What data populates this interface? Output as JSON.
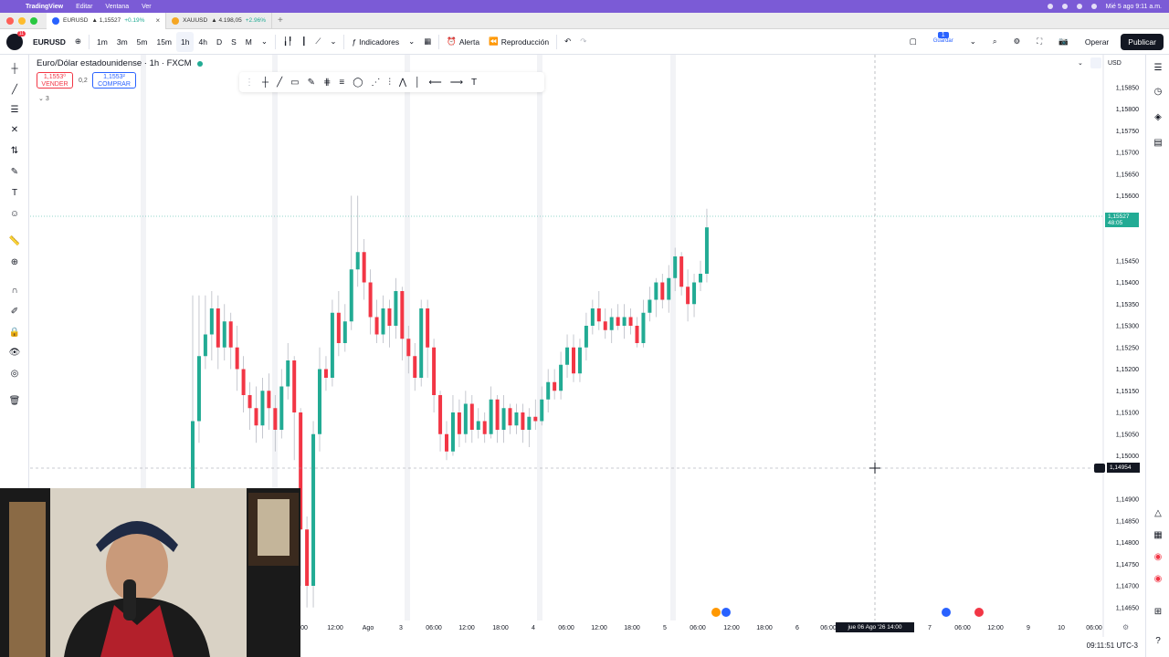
{
  "menubar": {
    "app_name": "TradingView",
    "items": [
      "Editar",
      "Ventana",
      "Ver"
    ],
    "clock": "Mié 5 ago  9:11 a.m."
  },
  "tabs": [
    {
      "symbol": "EURUSD",
      "price": "▲ 1,15527",
      "change": "+0.19%",
      "icon_color": "#2962ff",
      "active": true
    },
    {
      "symbol": "XAUUSD",
      "price": "▲ 4.198,05",
      "change": "+2.96%",
      "icon_color": "#f5a623",
      "active": false
    }
  ],
  "toolbar": {
    "symbol": "EURUSD",
    "intervals": [
      "1m",
      "3m",
      "5m",
      "15m",
      "1h",
      "4h",
      "D",
      "S",
      "M"
    ],
    "selected_interval": "1h",
    "indicators_label": "Indicadores",
    "alert_label": "Alerta",
    "replay_label": "Reproducción",
    "save_badge": "1",
    "save_label": "Guardar",
    "trade_label": "Operar",
    "publish_label": "Publicar"
  },
  "legend": {
    "title": "Euro/Dólar estadounidense · 1h · FXCM",
    "sell_price": "1,1553⁰",
    "sell_label": "VENDER",
    "spread": "0,2",
    "buy_price": "1,1553²",
    "buy_label": "COMPRAR",
    "collapse_count": "3"
  },
  "price_axis": {
    "currency": "USD",
    "current_price": "1,15527",
    "countdown": "48:05",
    "crosshair_price": "1,14954"
  },
  "time_axis": {
    "crosshair_time": "jue 06 Ago '26   14:00",
    "labels": [
      {
        "text": ":00",
        "x": 332
      },
      {
        "text": "12:00",
        "x": 367
      },
      {
        "text": "Ago",
        "x": 403
      },
      {
        "text": "3",
        "x": 439
      },
      {
        "text": "06:00",
        "x": 475
      },
      {
        "text": "12:00",
        "x": 511
      },
      {
        "text": "18:00",
        "x": 548
      },
      {
        "text": "4",
        "x": 584
      },
      {
        "text": "06:00",
        "x": 620
      },
      {
        "text": "12:00",
        "x": 656
      },
      {
        "text": "18:00",
        "x": 692
      },
      {
        "text": "5",
        "x": 728
      },
      {
        "text": "06:00",
        "x": 764
      },
      {
        "text": "12:00",
        "x": 801
      },
      {
        "text": "18:00",
        "x": 837
      },
      {
        "text": "6",
        "x": 873
      },
      {
        "text": "06:00",
        "x": 907
      },
      {
        "text": "7",
        "x": 1018
      },
      {
        "text": "06:00",
        "x": 1054
      },
      {
        "text": "12:00",
        "x": 1090
      },
      {
        "text": "9",
        "x": 1126
      },
      {
        "text": "10",
        "x": 1162
      },
      {
        "text": "06:00",
        "x": 1198
      }
    ],
    "bottom_clock": "09:11:51 UTC-3"
  },
  "chart_data": {
    "type": "candlestick",
    "title": "Euro/Dólar estadounidense · 1h · FXCM",
    "y_ticks": [
      "1,15800",
      "1,15750",
      "1,15700",
      "1,15650",
      "1,15600",
      "1,15550",
      "1,15450",
      "1,15400",
      "1,15350",
      "1,15300",
      "1,15250",
      "1,15200",
      "1,15150",
      "1,15100",
      "1,15050",
      "1,15000",
      "1,14900",
      "1,14850",
      "1,14800",
      "1,14750",
      "1,14700",
      "1,14650"
    ],
    "y_top_label": "1,15850",
    "ylim": [
      1.1462,
      1.159
    ],
    "x_start_index": 0,
    "up_color": "#22ab94",
    "down_color": "#f23645",
    "candles": [
      [
        1.149,
        1.1508,
        1.1537,
        1.1488
      ],
      [
        1.1508,
        1.1523,
        1.1537,
        1.1503
      ],
      [
        1.1523,
        1.1528,
        1.1537,
        1.152
      ],
      [
        1.1528,
        1.1534,
        1.1538,
        1.1522
      ],
      [
        1.1534,
        1.1525,
        1.1537,
        1.152
      ],
      [
        1.1525,
        1.1531,
        1.1535,
        1.1522
      ],
      [
        1.1531,
        1.1525,
        1.1533,
        1.152
      ],
      [
        1.1525,
        1.152,
        1.153,
        1.1515
      ],
      [
        1.152,
        1.1514,
        1.1523,
        1.151
      ],
      [
        1.1514,
        1.1511,
        1.1517,
        1.1506
      ],
      [
        1.1511,
        1.1507,
        1.1516,
        1.1503
      ],
      [
        1.1507,
        1.1515,
        1.1518,
        1.1504
      ],
      [
        1.1515,
        1.1511,
        1.1519,
        1.1506
      ],
      [
        1.1511,
        1.1506,
        1.1514,
        1.1501
      ],
      [
        1.1506,
        1.1516,
        1.152,
        1.1504
      ],
      [
        1.1516,
        1.1522,
        1.1526,
        1.1513
      ],
      [
        1.1522,
        1.151,
        1.1523,
        1.1499
      ],
      [
        1.151,
        1.1483,
        1.1511,
        1.147
      ],
      [
        1.1483,
        1.147,
        1.1486,
        1.1465
      ],
      [
        1.147,
        1.1505,
        1.1508,
        1.1465
      ],
      [
        1.1505,
        1.152,
        1.1525,
        1.1501
      ],
      [
        1.152,
        1.1518,
        1.1523,
        1.1515
      ],
      [
        1.1518,
        1.1533,
        1.1536,
        1.1516
      ],
      [
        1.1533,
        1.1526,
        1.1538,
        1.1523
      ],
      [
        1.1526,
        1.1531,
        1.1535,
        1.1524
      ],
      [
        1.1531,
        1.1543,
        1.156,
        1.1529
      ],
      [
        1.1543,
        1.1547,
        1.156,
        1.1539
      ],
      [
        1.1547,
        1.154,
        1.155,
        1.1536
      ],
      [
        1.154,
        1.1532,
        1.1543,
        1.1528
      ],
      [
        1.1532,
        1.1528,
        1.1536,
        1.1526
      ],
      [
        1.1528,
        1.1534,
        1.1537,
        1.1526
      ],
      [
        1.1534,
        1.153,
        1.1536,
        1.1525
      ],
      [
        1.153,
        1.1538,
        1.1541,
        1.1527
      ],
      [
        1.1538,
        1.1527,
        1.1539,
        1.1522
      ],
      [
        1.1527,
        1.1523,
        1.153,
        1.1519
      ],
      [
        1.1523,
        1.1518,
        1.1526,
        1.1515
      ],
      [
        1.1518,
        1.1534,
        1.1536,
        1.1516
      ],
      [
        1.1534,
        1.1525,
        1.1536,
        1.1518
      ],
      [
        1.1525,
        1.1514,
        1.1527,
        1.151
      ],
      [
        1.1514,
        1.1505,
        1.1515,
        1.1501
      ],
      [
        1.1505,
        1.1501,
        1.1508,
        1.1499
      ],
      [
        1.1501,
        1.151,
        1.1514,
        1.15
      ],
      [
        1.151,
        1.1505,
        1.1513,
        1.1502
      ],
      [
        1.1505,
        1.1512,
        1.1515,
        1.1503
      ],
      [
        1.1512,
        1.1506,
        1.1514,
        1.1503
      ],
      [
        1.1506,
        1.1508,
        1.1511,
        1.1504
      ],
      [
        1.1508,
        1.1505,
        1.151,
        1.1503
      ],
      [
        1.1505,
        1.1513,
        1.1516,
        1.1504
      ],
      [
        1.1513,
        1.1506,
        1.1514,
        1.1503
      ],
      [
        1.1506,
        1.1511,
        1.1514,
        1.1503
      ],
      [
        1.1511,
        1.1507,
        1.1512,
        1.1505
      ],
      [
        1.1507,
        1.151,
        1.1512,
        1.1505
      ],
      [
        1.151,
        1.1506,
        1.1512,
        1.1503
      ],
      [
        1.1506,
        1.1509,
        1.1511,
        1.1502
      ],
      [
        1.1509,
        1.1508,
        1.1513,
        1.1506
      ],
      [
        1.1508,
        1.1513,
        1.1516,
        1.1507
      ],
      [
        1.1513,
        1.1517,
        1.152,
        1.151
      ],
      [
        1.1517,
        1.1515,
        1.152,
        1.1513
      ],
      [
        1.1515,
        1.1521,
        1.1524,
        1.1513
      ],
      [
        1.1521,
        1.1525,
        1.1528,
        1.1518
      ],
      [
        1.1525,
        1.1519,
        1.1528,
        1.1517
      ],
      [
        1.1519,
        1.1525,
        1.1527,
        1.1517
      ],
      [
        1.1525,
        1.153,
        1.1533,
        1.1522
      ],
      [
        1.153,
        1.1534,
        1.1536,
        1.1528
      ],
      [
        1.1534,
        1.1531,
        1.1538,
        1.1529
      ],
      [
        1.1531,
        1.1529,
        1.1534,
        1.1527
      ],
      [
        1.1529,
        1.1532,
        1.1534,
        1.1526
      ],
      [
        1.1532,
        1.153,
        1.1535,
        1.1529
      ],
      [
        1.153,
        1.1532,
        1.1535,
        1.1527
      ],
      [
        1.1532,
        1.153,
        1.1534,
        1.1528
      ],
      [
        1.153,
        1.1526,
        1.1532,
        1.1525
      ],
      [
        1.1526,
        1.1533,
        1.1536,
        1.1525
      ],
      [
        1.1533,
        1.1536,
        1.1539,
        1.1531
      ],
      [
        1.1536,
        1.154,
        1.1541,
        1.1532
      ],
      [
        1.154,
        1.1536,
        1.1542,
        1.1534
      ],
      [
        1.1536,
        1.1541,
        1.1544,
        1.1533
      ],
      [
        1.1541,
        1.1546,
        1.1548,
        1.1538
      ],
      [
        1.1546,
        1.1539,
        1.1547,
        1.1537
      ],
      [
        1.1539,
        1.1535,
        1.1543,
        1.1531
      ],
      [
        1.1535,
        1.154,
        1.1542,
        1.1532
      ],
      [
        1.154,
        1.1542,
        1.1545,
        1.1538
      ],
      [
        1.1542,
        1.15527,
        1.1557,
        1.154
      ]
    ]
  },
  "webcam": {
    "description_color": "#d9d2c5"
  }
}
